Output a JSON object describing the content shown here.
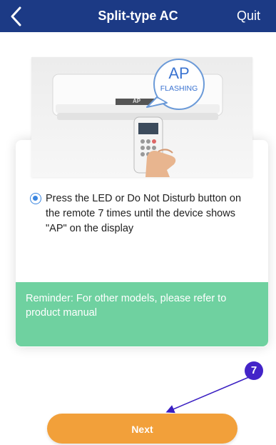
{
  "header": {
    "title": "Split-type AC",
    "quit_label": "Quit",
    "background": "#1c3a85"
  },
  "illustration": {
    "bubble_big": "AP",
    "bubble_small": "FLASHING",
    "unit_display": "AP",
    "icons": [
      "air-conditioner",
      "remote-control",
      "hand"
    ]
  },
  "option": {
    "text": "Press the LED or Do Not Disturb button on the remote 7 times until the device shows \"AP\" on the display",
    "selected": true
  },
  "reminder": {
    "text": "Reminder: For other models, please refer to product manual",
    "color": "#6fd1a0"
  },
  "next_label": "Next",
  "next_color": "#f2a03a",
  "annotation": {
    "badge": "7",
    "color": "#4324c8"
  }
}
